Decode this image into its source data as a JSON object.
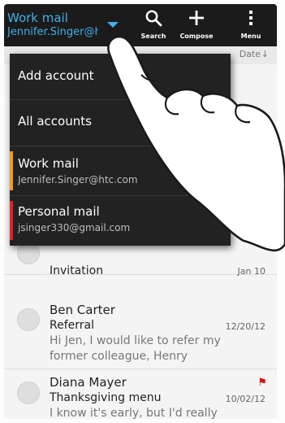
{
  "action_bar": {
    "account_title": "Work mail",
    "account_subtitle": "Jennifer.Singer@htc.com",
    "search_label": "Search",
    "compose_label": "Compose",
    "menu_label": "Menu"
  },
  "sort_bar": {
    "label": "Date"
  },
  "dropdown": {
    "add_account": "Add account",
    "all_accounts": "All accounts",
    "accounts": [
      {
        "name": "Work mail",
        "email": "Jennifer.Singer@htc.com",
        "color": "#f29b1f"
      },
      {
        "name": "Personal mail",
        "email": "jsinger330@gmail.com",
        "color": "#d8262a"
      }
    ]
  },
  "messages": [
    {
      "subject": "Invitation",
      "date": "Jan 10"
    },
    {
      "sender": "Ben Carter",
      "subject": "Referral",
      "date": "12/20/12",
      "preview": "Hi Jen, I would like to refer my former colleague, Henry"
    },
    {
      "sender": "Diana Mayer",
      "subject": "Thanksgiving menu",
      "date": "10/02/12",
      "preview": "I know it's early, but I'd really",
      "flagged": true
    }
  ],
  "colors": {
    "accent": "#3fb0e8",
    "flag": "#d4141c"
  }
}
